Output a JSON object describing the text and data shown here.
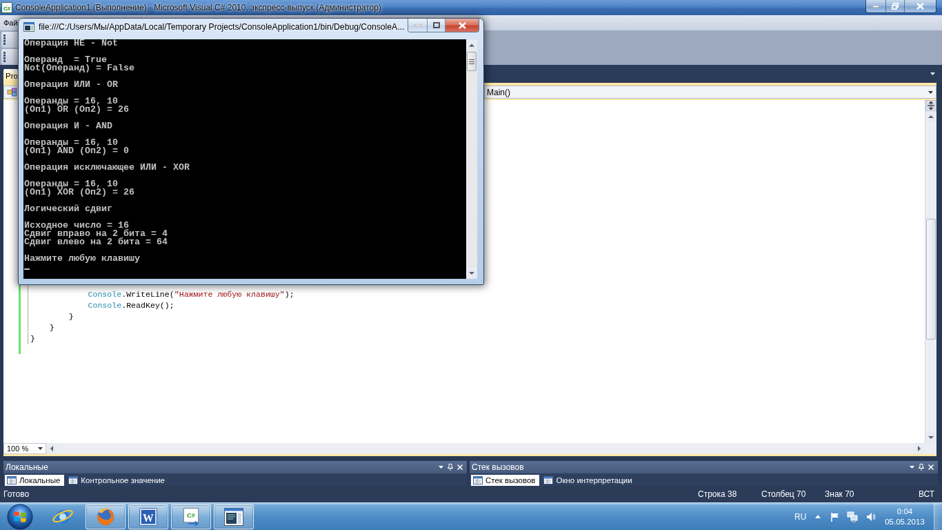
{
  "window": {
    "icon_text": "C#",
    "title": "ConsoleApplication1 (Выполнение) - Microsoft Visual C# 2010, экспресс-выпуск (Администратор)"
  },
  "menu": [
    "Фай"
  ],
  "document_tabs": [
    {
      "label": "Pro",
      "selected": true
    }
  ],
  "navigation_bar": {
    "member": "Main()"
  },
  "editor": {
    "lines": [
      {
        "tokens": [
          {
            "kind": "type",
            "text": "            Console"
          },
          {
            "kind": "plain",
            "text": ".WriteLine("
          },
          {
            "kind": "string",
            "text": "\"Нажмите любую клавишу\""
          },
          {
            "kind": "plain",
            "text": ");"
          }
        ]
      },
      {
        "tokens": [
          {
            "kind": "type",
            "text": "            Console"
          },
          {
            "kind": "plain",
            "text": ".ReadKey();"
          }
        ]
      },
      {
        "tokens": [
          {
            "kind": "plain",
            "text": "        }"
          }
        ]
      },
      {
        "tokens": [
          {
            "kind": "plain",
            "text": "    }"
          }
        ]
      },
      {
        "tokens": [
          {
            "kind": "plain",
            "text": "}"
          }
        ]
      }
    ],
    "zoom": "100 %"
  },
  "tool_windows": [
    {
      "title": "Локальные",
      "tabs": [
        {
          "label": "Локальные",
          "selected": true
        },
        {
          "label": "Контрольное значение",
          "selected": false
        }
      ]
    },
    {
      "title": "Стек вызовов",
      "tabs": [
        {
          "label": "Стек вызовов",
          "selected": true
        },
        {
          "label": "Окно интерпретации",
          "selected": false
        }
      ]
    }
  ],
  "status_bar": {
    "message": "Готово",
    "line": "Строка 38",
    "column": "Столбец 70",
    "char": "Знак 70",
    "mode": "ВСТ"
  },
  "taskbar": {
    "apps": [
      {
        "kind": "ie",
        "running": false
      },
      {
        "kind": "firefox",
        "running": true
      },
      {
        "kind": "word",
        "running": true,
        "icon_text": "W"
      },
      {
        "kind": "csharp",
        "running": true,
        "icon_text": "C#"
      },
      {
        "kind": "console",
        "running": true
      }
    ],
    "language": "RU",
    "time": "0:04",
    "date": "05.05.2013"
  },
  "console_window": {
    "title": "file:///C:/Users/Мы/AppData/Local/Temporary Projects/ConsoleApplication1/bin/Debug/ConsoleA...",
    "blocks": [
      [
        "Операция НЕ - Not"
      ],
      [
        "Операнд  = True",
        "Not(Операнд) = False"
      ],
      [
        "Операция ИЛИ - OR"
      ],
      [
        "Операнды = 16, 10",
        "(Оп1) OR (Оп2) = 26"
      ],
      [
        "Операция И - AND"
      ],
      [
        "Операнды = 16, 10",
        "(Оп1) AND (Оп2) = 0"
      ],
      [
        "Операция исключающее ИЛИ - XOR"
      ],
      [
        "Операнды = 16, 10",
        "(Оп1) XOR (Оп2) = 26"
      ],
      [
        "Логический сдвиг"
      ],
      [
        "Исходное число = 16",
        "Сдвиг вправо на 2 бита = 4",
        "Сдвиг влево на 2 бита = 64"
      ],
      [
        "Нажмите любую клавишу"
      ]
    ]
  }
}
